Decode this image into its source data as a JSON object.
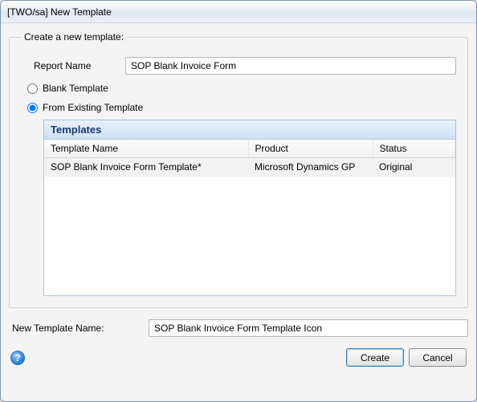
{
  "window": {
    "title": "[TWO/sa] New Template"
  },
  "group": {
    "legend": "Create a new template:",
    "report_name_label": "Report Name",
    "report_name_value": "SOP Blank Invoice Form"
  },
  "options": {
    "blank_label": "Blank Template",
    "existing_label": "From Existing Template",
    "selected": "existing"
  },
  "templates": {
    "panel_title": "Templates",
    "columns": {
      "name": "Template Name",
      "product": "Product",
      "status": "Status"
    },
    "rows": [
      {
        "name": "SOP Blank Invoice Form Template*",
        "product": "Microsoft Dynamics GP",
        "status": "Original"
      }
    ]
  },
  "new_template": {
    "label": "New Template Name:",
    "value": "SOP Blank Invoice Form Template Icon"
  },
  "footer": {
    "help_glyph": "?",
    "create": "Create",
    "cancel": "Cancel"
  }
}
